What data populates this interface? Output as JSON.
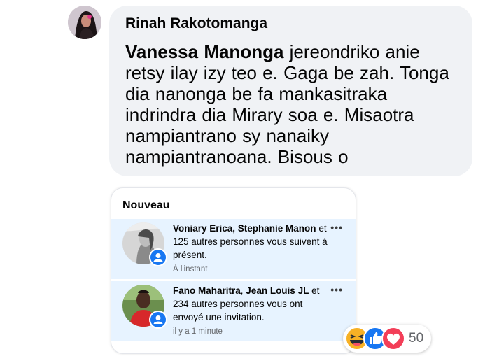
{
  "comment": {
    "author": "Rinah Rakotomanga",
    "mention": "Vanessa Manonga",
    "text": " jereondriko anie retsy ilay izy teo e. Gaga be zah. Tonga dia nanonga be fa mankasitraka indrindra dia Mirary soa e. Misaotra nampiantrano sy nanaiky nampiantranoana. Bisous o"
  },
  "notifications": {
    "section_title": "Nouveau",
    "items": [
      {
        "names": "Voniary Erica, Stephanie Manon",
        "text": " et 125 autres personnes vous suivent à présent.",
        "time": "À l'instant"
      },
      {
        "names1": "Fano Maharitra",
        "sep": ", ",
        "names2": "Jean Louis JL",
        "text": " et 234 autres personnes vous ont envoyé une invitation.",
        "time": "il y a 1 minute"
      }
    ],
    "more_label": "•••"
  },
  "reactions": {
    "icons": [
      "haha-icon",
      "like-icon",
      "love-icon"
    ],
    "count": "50",
    "colors": {
      "like": "#1877f2",
      "love": "#f33e58",
      "haha": "#f7b125"
    }
  }
}
